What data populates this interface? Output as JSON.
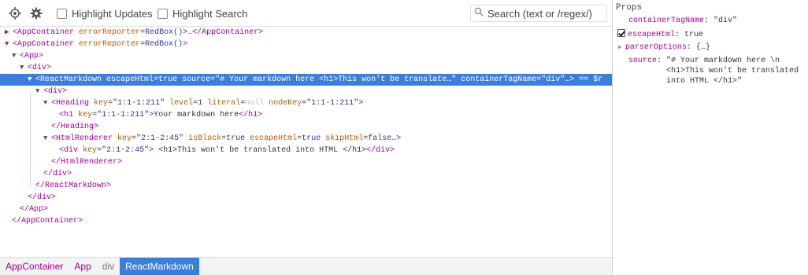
{
  "toolbar": {
    "settings_icon": "gear-icon",
    "inspect_icon": "target-icon",
    "highlight_updates_label": "Highlight Updates",
    "highlight_search_label": "Highlight Search",
    "search_placeholder": "Search (text or /regex/)"
  },
  "tree": {
    "rows": [
      {
        "arrow": "▶",
        "tag": "AppContainer",
        "attr": "errorReporter",
        "value": "RedBox()",
        "tail": ">…</AppContainer>"
      },
      {
        "arrow": "▼",
        "tag": "AppContainer",
        "attr": "errorReporter",
        "value": "RedBox()",
        "tail": ">"
      },
      {
        "arrow": "▼",
        "open": "<App>"
      },
      {
        "arrow": "▼",
        "open": "<div>"
      },
      {
        "arrow": "▼",
        "tag": "ReactMarkdown",
        "attrs": [
          {
            "name": "escapeHtml",
            "value": "true"
          },
          {
            "name": "source",
            "value": "\"# Your markdown here <h1>This won't be translate…\""
          },
          {
            "name": "containerTagName",
            "value": "\"div\""
          }
        ],
        "tail": "…> == $r"
      },
      {
        "arrow": "▼",
        "open": "<div>"
      },
      {
        "arrow": "▼",
        "tag": "Heading",
        "attrs": [
          {
            "name": "key",
            "value": "\"1:1-1:211\""
          },
          {
            "name": "level",
            "value": "1"
          },
          {
            "name": "literal",
            "value": "null"
          },
          {
            "name": "nodeKey",
            "value": "\"1:1-1:211\""
          }
        ],
        "tail": ">"
      },
      {
        "tag": "h1",
        "attrs": [
          {
            "name": "key",
            "value": "\"1:1-1:211\""
          }
        ],
        "text": "Your markdown here",
        "close": "</h1>"
      },
      {
        "close": "</Heading>"
      },
      {
        "arrow": "▼",
        "tag": "HtmlRenderer",
        "attrs": [
          {
            "name": "key",
            "value": "\"2:1-2:45\""
          },
          {
            "name": "isBlock",
            "value": "true"
          },
          {
            "name": "escapeHtml",
            "value": "true"
          },
          {
            "name": "skipHtml",
            "value": "false…"
          }
        ],
        "tail": ">"
      },
      {
        "tag": "div",
        "attrs": [
          {
            "name": "key",
            "value": "\"2:1-2:45\""
          }
        ],
        "text": " <h1>This won't be translated into HTML </h1>",
        "close": "</div>"
      },
      {
        "close": "</HtmlRenderer>"
      },
      {
        "close": "</div>"
      },
      {
        "close": "</ReactMarkdown>"
      },
      {
        "close": "</div>"
      },
      {
        "close": "</App>"
      },
      {
        "close": "</AppContainer>"
      }
    ]
  },
  "breadcrumbs": [
    "AppContainer",
    "App",
    "div",
    "ReactMarkdown"
  ],
  "props": {
    "title": "Props",
    "items": [
      {
        "name": "containerTagName",
        "value": "\"div\""
      },
      {
        "name": "escapeHtml",
        "value": "true"
      },
      {
        "name": "parserOptions",
        "value": "{…}"
      },
      {
        "name": "source",
        "value_lines": [
          "\"# Your markdown here \\n",
          "<h1>This won't be translated",
          "into HTML </h1>\""
        ]
      }
    ]
  }
}
